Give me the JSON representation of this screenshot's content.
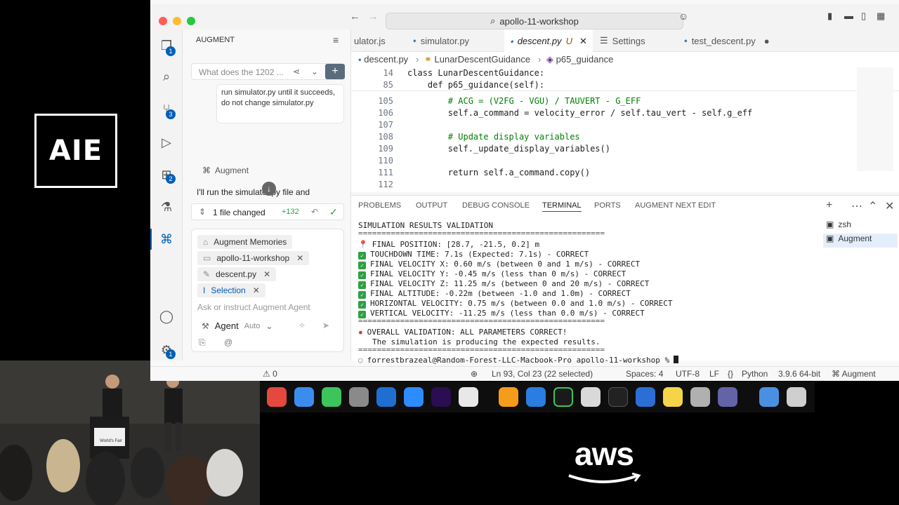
{
  "brand": {
    "logo": "AIE",
    "sponsor": "aws"
  },
  "window": {
    "title": "apollo-11-workshop"
  },
  "sidebar": {
    "title": "AUGMENT",
    "thread_title": "What does the 1202 ...",
    "user_message": "run simulator.py until it succeeds, do not change simulator.py",
    "agent_label": "Augment",
    "agent_reply": "I'll run the simulator.py file and",
    "changes": "1 file changed",
    "changes_count": "+132",
    "context_items": [
      "Augment Memories",
      "apollo-11-workshop",
      "descent.py",
      "Selection"
    ],
    "input_placeholder": "Ask or instruct Augment Agent",
    "mode": "Agent",
    "auto": "Auto"
  },
  "tabs": [
    {
      "label": "ulator.js"
    },
    {
      "label": "simulator.py"
    },
    {
      "label": "descent.py",
      "suffix": "U"
    },
    {
      "label": "Settings"
    },
    {
      "label": "test_descent.py"
    }
  ],
  "breadcrumb": {
    "file": "descent.py",
    "class": "LunarDescentGuidance",
    "method": "p65_guidance"
  },
  "sticky": [
    {
      "n": "14",
      "code": "class LunarDescentGuidance:"
    },
    {
      "n": "85",
      "code": "    def p65_guidance(self):"
    }
  ],
  "code": [
    {
      "n": "105",
      "code": "        # ACG = (V2FG - VGU) / TAUVERT - G_EFF"
    },
    {
      "n": "106",
      "code": "        self.a_command = velocity_error / self.tau_vert - self.g_eff"
    },
    {
      "n": "107",
      "code": ""
    },
    {
      "n": "108",
      "code": "        # Update display variables"
    },
    {
      "n": "109",
      "code": "        self._update_display_variables()"
    },
    {
      "n": "110",
      "code": ""
    },
    {
      "n": "111",
      "code": "        return self.a_command.copy()"
    },
    {
      "n": "112",
      "code": ""
    }
  ],
  "panel_tabs": [
    "PROBLEMS",
    "OUTPUT",
    "DEBUG CONSOLE",
    "TERMINAL",
    "PORTS",
    "AUGMENT NEXT EDIT"
  ],
  "terminals": [
    "zsh",
    "Augment"
  ],
  "terminal": {
    "heading": "SIMULATION RESULTS VALIDATION",
    "rule": "=====================================================",
    "position": "FINAL POSITION: [28.7, -21.5, 0.2] m",
    "checks": [
      "TOUCHDOWN TIME: 7.1s (Expected: 7.1s) - CORRECT",
      "FINAL VELOCITY X: 0.60 m/s (between 0 and 1 m/s) - CORRECT",
      "FINAL VELOCITY Y: -0.45 m/s (less than 0 m/s) - CORRECT",
      "FINAL VELOCITY Z: 11.25 m/s (between 0 and 20 m/s) - CORRECT",
      "FINAL ALTITUDE: -0.22m (between -1.0 and 1.0m) - CORRECT",
      "HORIZONTAL VELOCITY: 0.75 m/s (between 0.0 and 1.0 m/s) - CORRECT",
      "VERTICAL VELOCITY: -11.25 m/s (less than 0.0 m/s) - CORRECT"
    ],
    "overall": "OVERALL VALIDATION: ALL PARAMETERS CORRECT!",
    "overall_sub": "The simulation is producing the expected results.",
    "prompt": "forrestbrazeal@Random-Forest-LLC-Macbook-Pro apollo-11-workshop %"
  },
  "status": {
    "errors": "0",
    "position": "Ln 93, Col 23 (22 selected)",
    "spaces": "Spaces: 4",
    "encoding": "UTF-8",
    "eol": "LF",
    "lang_braces": "{}",
    "lang": "Python",
    "version": "3.9.6 64-bit",
    "augment": "Augment"
  },
  "stage_sign": "World's Fair",
  "colors": {
    "accent": "#005fb8",
    "check": "#2ea043"
  }
}
